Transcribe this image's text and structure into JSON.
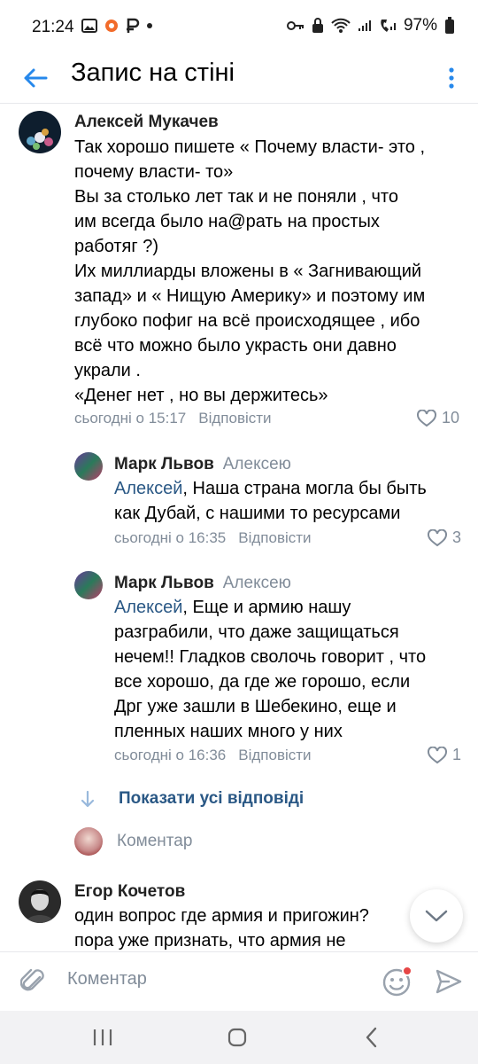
{
  "status_bar": {
    "time": "21:24",
    "battery": "97%"
  },
  "header": {
    "title": "Запис на стіні"
  },
  "comments": [
    {
      "author": "Алексей Мукачев",
      "reply_to": "",
      "mention": "",
      "text": "Так хорошо пишете « Почему власти- это ,\nпочему власти- то»\nВы за столько лет так и не поняли , что\nим всегда было на@рать на простых\nработяг ?)\nИх миллиарды вложены в « Загнивающий\nзапад» и « Нищую Америку» и поэтому им\nглубоко пофиг на всё происходящее , ибо\nвсё что можно было украсть они давно\nукрали .\n«Денег нет , но вы держитесь»",
      "time": "сьогодні о 15:17",
      "reply_label": "Відповісти",
      "likes": "10"
    },
    {
      "author": "Марк Львов",
      "reply_to": "Алексею",
      "mention": "Алексей",
      "text": ", Наша страна могла бы быть\nкак Дубай, с нашими то ресурсами",
      "time": "сьогодні о 16:35",
      "reply_label": "Відповісти",
      "likes": "3"
    },
    {
      "author": "Марк Львов",
      "reply_to": "Алексею",
      "mention": "Алексей",
      "text": ", Еще и армию нашу\nразграбили, что даже защищаться\nнечем!! Гладков сволочь говорит , что\nвсе хорошо, да где же горошо, если\nДрг уже зашли в Шебекино, еще и\nпленных наших много у них",
      "time": "сьогодні о 16:36",
      "reply_label": "Відповісти",
      "likes": "1"
    },
    {
      "author": "Егор Кочетов",
      "reply_to": "",
      "mention": "",
      "text": "один вопрос где армия и пригожин?\nпора уже признать, что армия не",
      "time": "",
      "reply_label": "",
      "likes": ""
    }
  ],
  "thread": {
    "show_all_label": "Показати усі відповіді",
    "reply_placeholder": "Коментар"
  },
  "composer": {
    "placeholder": "Коментар"
  },
  "colors": {
    "accent": "#2a5885",
    "icon_blue": "#2688eb",
    "muted": "#818c99",
    "notification_dot": "#e64646"
  },
  "icons": [
    "back-arrow-icon",
    "more-vertical-icon",
    "heart-icon",
    "arrow-down-icon",
    "chevron-down-icon",
    "paperclip-icon",
    "emoji-icon",
    "send-icon",
    "recents-icon",
    "home-icon",
    "back-icon"
  ]
}
